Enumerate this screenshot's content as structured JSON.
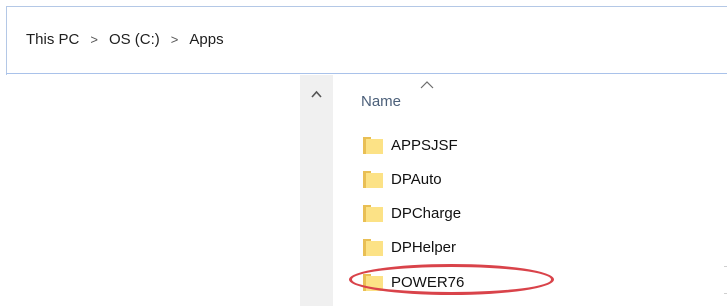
{
  "breadcrumb": {
    "items": [
      "This PC",
      "OS (C:)",
      "Apps"
    ],
    "separator": ">"
  },
  "columns": {
    "name_label": "Name"
  },
  "folders": [
    {
      "label": "APPSJSF"
    },
    {
      "label": "DPAuto"
    },
    {
      "label": "DPCharge"
    },
    {
      "label": "DPHelper"
    },
    {
      "label": "POWER76",
      "highlighted": true
    }
  ],
  "colors": {
    "folder_fill": "#fce286",
    "folder_tab": "#e9bf54",
    "highlight_ring": "#d9434a",
    "address_border": "#a9c2ea"
  },
  "icons": {
    "folder": "folder-icon",
    "scroll_up": "chevron-up-icon",
    "sort": "sort-ascending-icon"
  }
}
